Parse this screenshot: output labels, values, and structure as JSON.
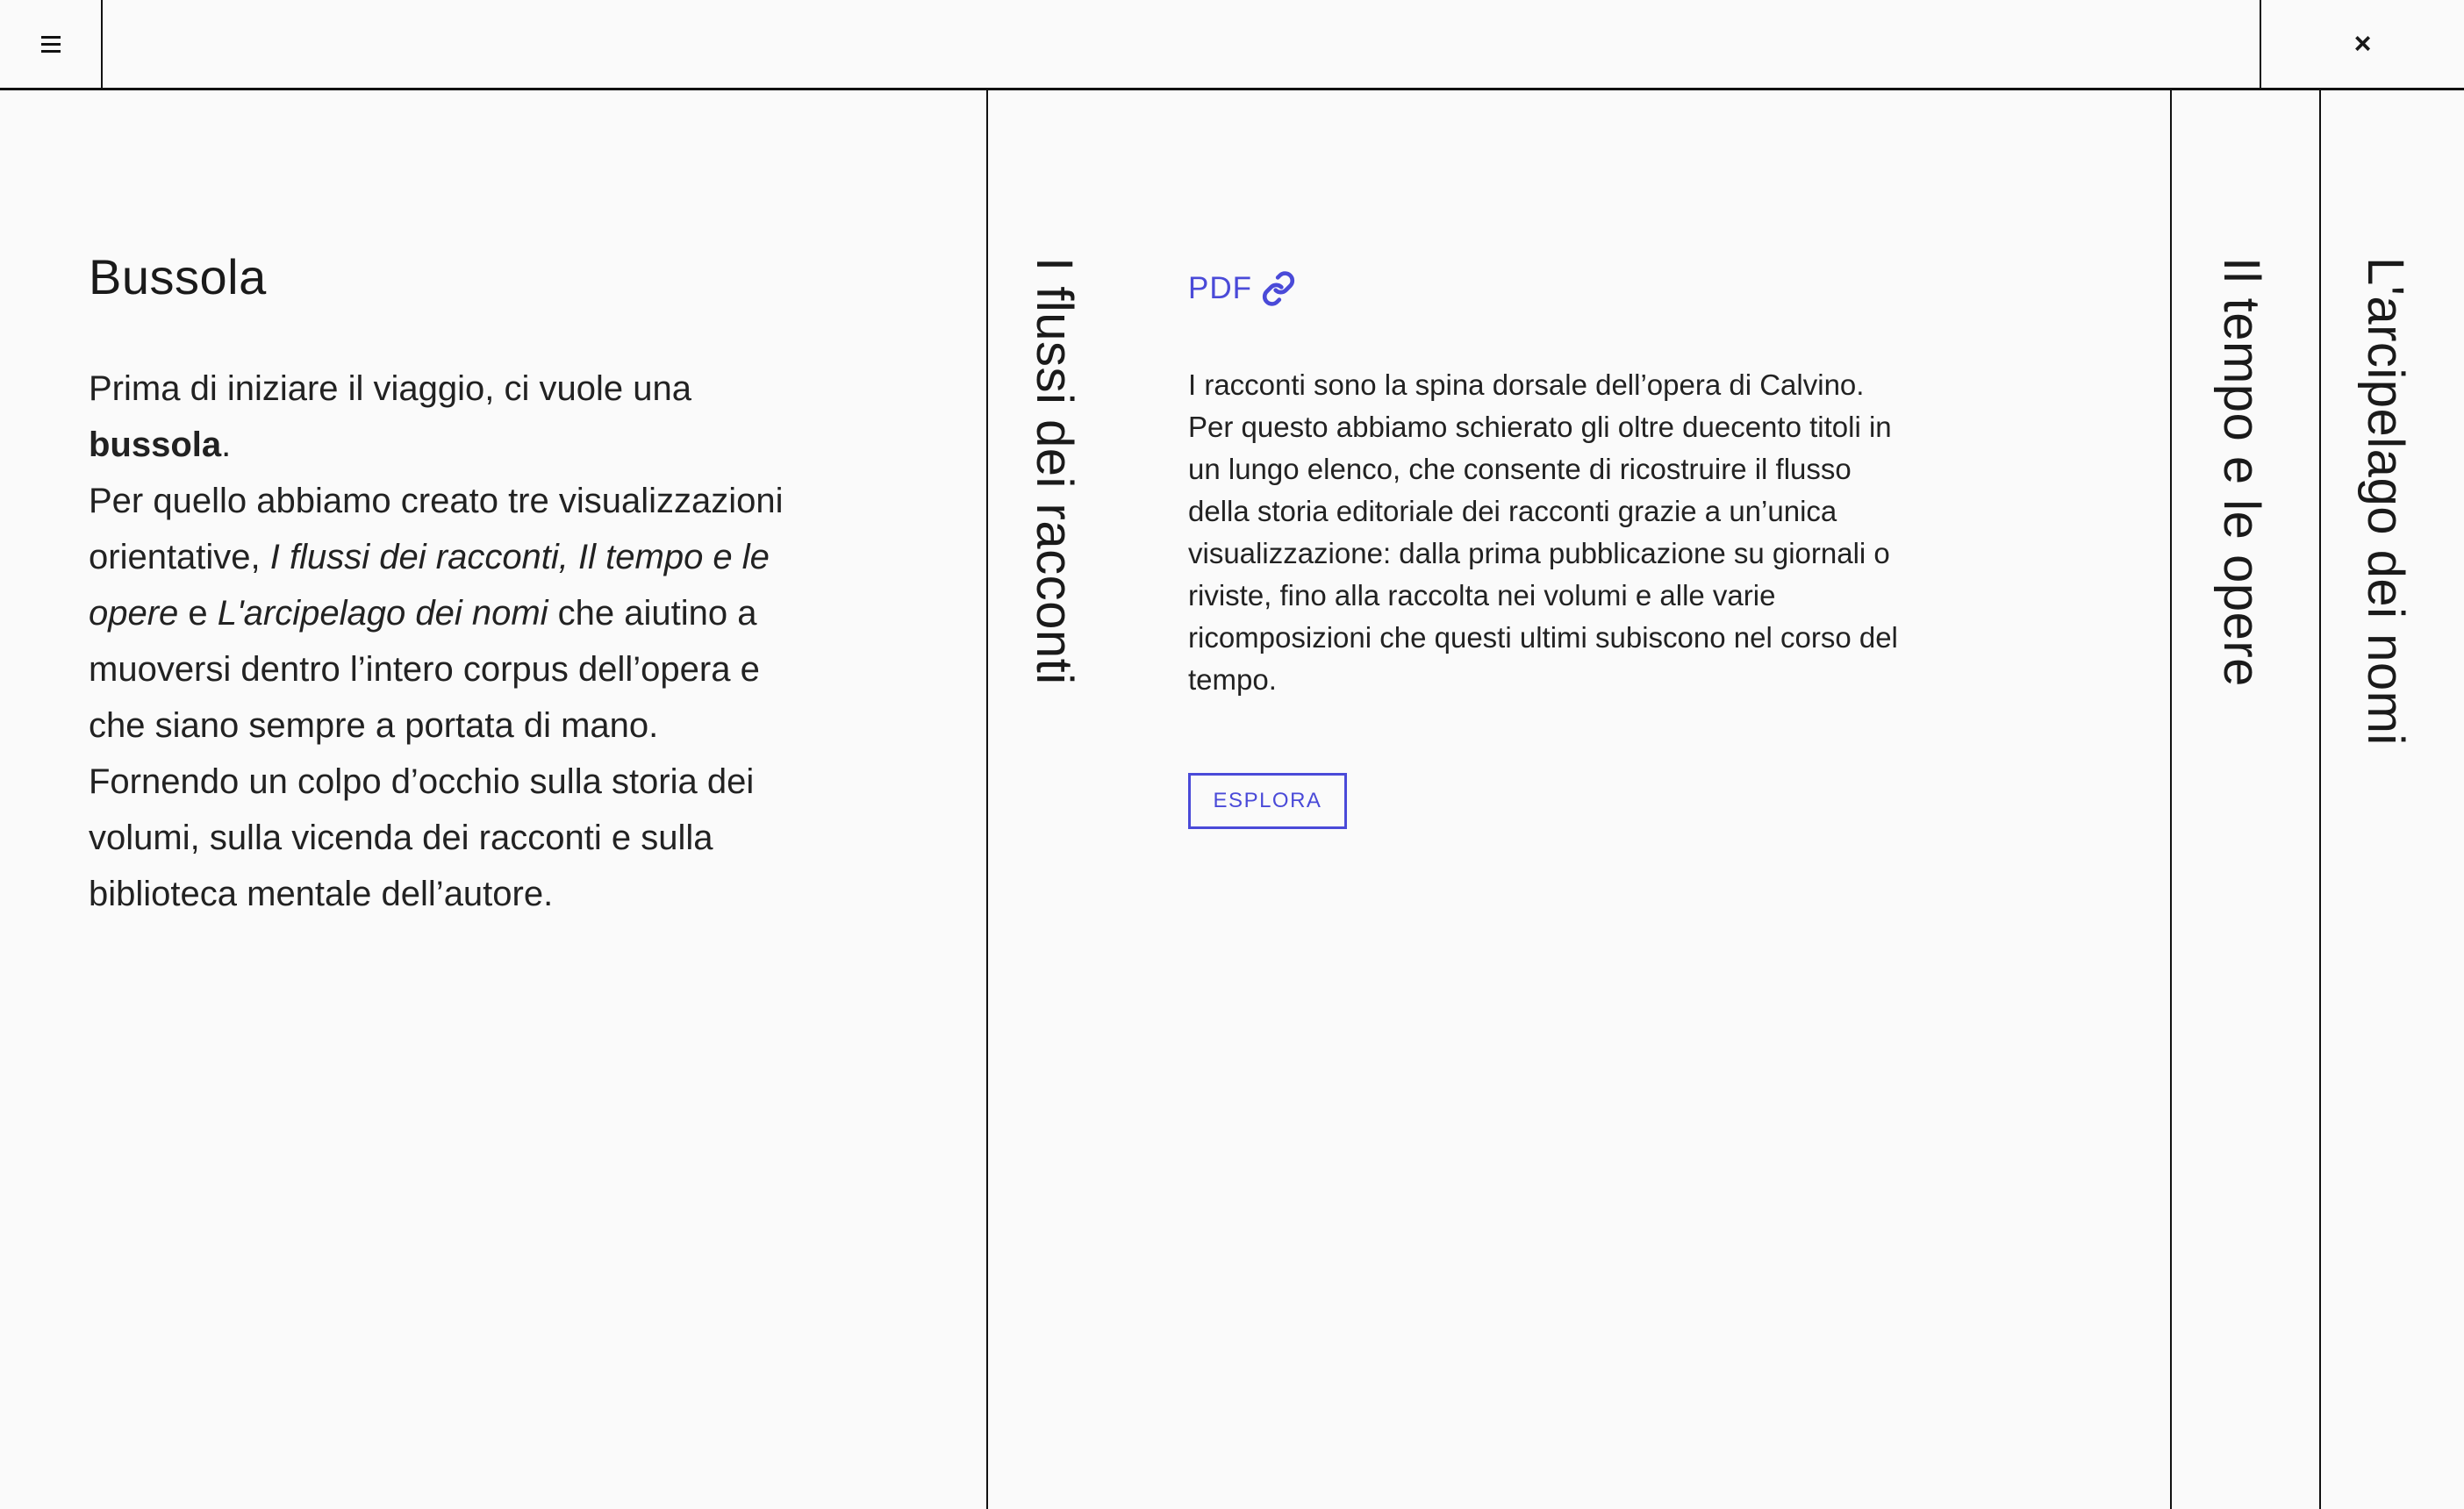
{
  "header": {
    "menu_icon": "hamburger-icon",
    "close_icon": "close-icon",
    "close_glyph": "×"
  },
  "bussola": {
    "title": "Bussola",
    "para1_text": "Prima di iniziare il viaggio, ci vuole una ",
    "para1_bold": "bussola",
    "para1_end": ".",
    "para2_text": "Per quello abbiamo creato tre visualizzazioni orientative, ",
    "para2_italic1": "I flussi dei racconti, Il tempo e le opere",
    "para2_and": " e ",
    "para2_italic2": "L'arcipelago dei nomi",
    "para2_rest": " che aiutino a muoversi dentro l’intero corpus dell’opera e che siano sempre a portata di mano. Fornendo un colpo d’occhio sulla storia dei volumi, sulla vicenda dei racconti e sulla biblioteca mentale dell’autore."
  },
  "flussi": {
    "vertical_title": "I flussi dei racconti",
    "pdf_label": "PDF",
    "pdf_icon": "link-icon",
    "description": "I racconti sono la spina dorsale dell’opera di Calvino. Per questo abbiamo schierato gli oltre duecento titoli in un lungo elenco, che consente di ricostruire il flusso della storia editoriale dei racconti grazie a un’unica visualizzazione: dalla prima pubblicazione su giornali o riviste, fino alla raccolta nei volumi e alle varie ricomposizioni che questi ultimi subiscono nel corso del tempo.",
    "button_label": "ESPLORA"
  },
  "tempo": {
    "vertical_title": "Il tempo e le opere"
  },
  "arcipelago": {
    "vertical_title": "L'arcipelago dei nomi"
  },
  "colors": {
    "accent": "#4a4ad8",
    "background": "#fafafa",
    "text": "#1a1a1a"
  }
}
